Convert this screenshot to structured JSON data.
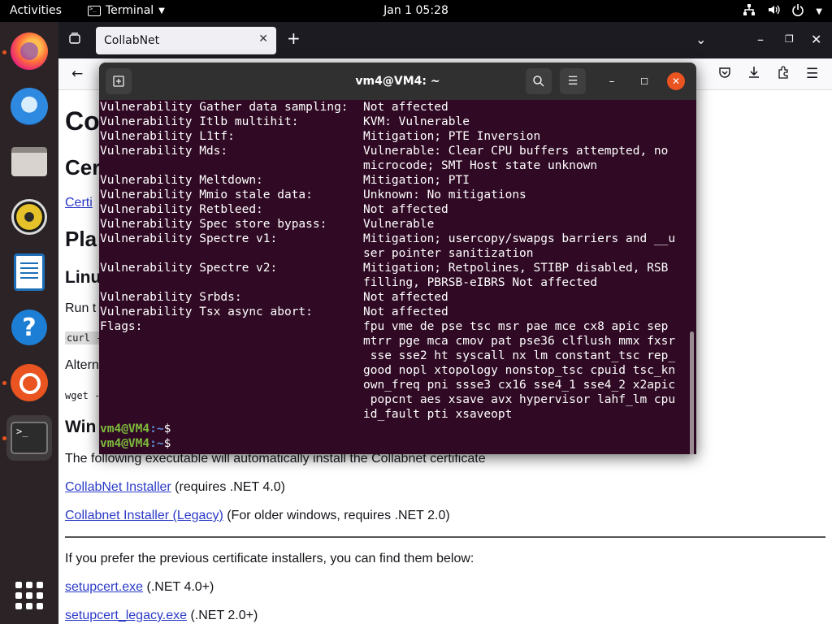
{
  "topbar": {
    "activities": "Activities",
    "app_name": "Terminal",
    "clock": "Jan 1  05:28"
  },
  "dock": {
    "items": [
      "Firefox",
      "Thunderbird",
      "Files",
      "Rhythmbox",
      "LibreOffice Writer",
      "Help",
      "Ubuntu Software",
      "Terminal",
      "Show Applications"
    ]
  },
  "browser": {
    "tab_title": "CollabNet",
    "content": {
      "heading1": "Co",
      "heading2": "Cer",
      "link1": "Certi",
      "heading_platform": "Pla",
      "heading_linux": "Linu",
      "run_text": "Run t",
      "curl_code": "curl -",
      "alt_text": "Altern",
      "wget_code": "wget -",
      "heading_windows": "Win",
      "installer_text": "The following executable will automatically install the Collabnet certificate",
      "installer_link": "CollabNet Installer",
      "installer_note": " (requires .NET 4.0)",
      "legacy_link": "Collabnet Installer (Legacy)",
      "legacy_note": " (For older windows, requires .NET 2.0)",
      "prefer_text": "If you prefer the previous certificate installers, you can find them below:",
      "setupcert_link": "setupcert.exe",
      "setupcert_note": " (.NET 4.0+)",
      "setupcert_legacy_link": "setupcert_legacy.exe",
      "setupcert_legacy_note": " (.NET 2.0+)"
    }
  },
  "terminal": {
    "title": "vm4@VM4: ~",
    "lines": [
      {
        "key": "Vulnerability Gather data sampling:",
        "value": "Not affected"
      },
      {
        "key": "Vulnerability Itlb multihit:",
        "value": "KVM: Vulnerable"
      },
      {
        "key": "Vulnerability L1tf:",
        "value": "Mitigation; PTE Inversion"
      },
      {
        "key": "Vulnerability Mds:",
        "value": "Vulnerable: Clear CPU buffers attempted, no"
      },
      {
        "key": "",
        "value": "microcode; SMT Host state unknown"
      },
      {
        "key": "Vulnerability Meltdown:",
        "value": "Mitigation; PTI"
      },
      {
        "key": "Vulnerability Mmio stale data:",
        "value": "Unknown: No mitigations"
      },
      {
        "key": "Vulnerability Retbleed:",
        "value": "Not affected"
      },
      {
        "key": "Vulnerability Spec store bypass:",
        "value": "Vulnerable"
      },
      {
        "key": "Vulnerability Spectre v1:",
        "value": "Mitigation; usercopy/swapgs barriers and __u"
      },
      {
        "key": "",
        "value": "ser pointer sanitization"
      },
      {
        "key": "Vulnerability Spectre v2:",
        "value": "Mitigation; Retpolines, STIBP disabled, RSB"
      },
      {
        "key": "",
        "value": "filling, PBRSB-eIBRS Not affected"
      },
      {
        "key": "Vulnerability Srbds:",
        "value": "Not affected"
      },
      {
        "key": "Vulnerability Tsx async abort:",
        "value": "Not affected"
      },
      {
        "key": "Flags:",
        "value": "fpu vme de pse tsc msr pae mce cx8 apic sep"
      },
      {
        "key": "",
        "value": "mtrr pge mca cmov pat pse36 clflush mmx fxsr"
      },
      {
        "key": "",
        "value": " sse sse2 ht syscall nx lm constant_tsc rep_"
      },
      {
        "key": "",
        "value": "good nopl xtopology nonstop_tsc cpuid tsc_kn"
      },
      {
        "key": "",
        "value": "own_freq pni ssse3 cx16 sse4_1 sse4_2 x2apic"
      },
      {
        "key": "",
        "value": " popcnt aes xsave avx hypervisor lahf_lm cpu"
      },
      {
        "key": "",
        "value": "id_fault pti xsaveopt"
      }
    ],
    "prompt_user": "vm4@VM4",
    "prompt_path": ":~",
    "prompt_symbol": "$"
  }
}
